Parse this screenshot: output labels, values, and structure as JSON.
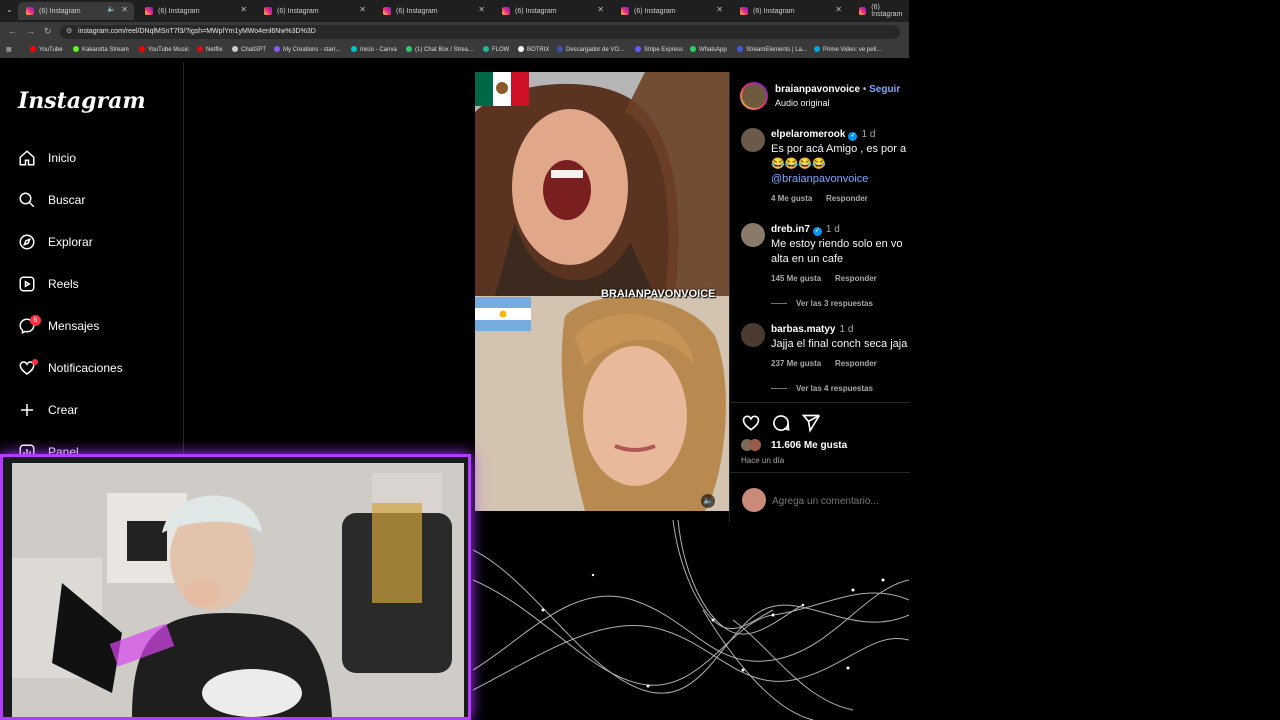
{
  "browser": {
    "tabs": [
      {
        "title": "(6) Instagram",
        "active": true
      },
      {
        "title": "(6) Instagram"
      },
      {
        "title": "(6) Instagram"
      },
      {
        "title": "(6) Instagram"
      },
      {
        "title": "(6) Instagram"
      },
      {
        "title": "(6) Instagram"
      },
      {
        "title": "(6) Instagram"
      },
      {
        "title": "(6) Instagram"
      }
    ],
    "url": "instagram.com/reel/DNqlMSnT7f3/?igsh=MWplYm1yMWo4enl6Nw%3D%3D",
    "bookmarks": [
      {
        "label": "YouTube",
        "color": "#ff0000"
      },
      {
        "label": "Kakarotta Stream",
        "color": "#53fc18"
      },
      {
        "label": "YouTube Music",
        "color": "#ff0000"
      },
      {
        "label": "Netflix",
        "color": "#e50914"
      },
      {
        "label": "ChatGPT",
        "color": "#cccccc"
      },
      {
        "label": "My Creations - starr...",
        "color": "#8a5cf6"
      },
      {
        "label": "Inicio - Canva",
        "color": "#00c4cc"
      },
      {
        "label": "(1) Chat Box / Strea...",
        "color": "#2ecc71"
      },
      {
        "label": "FLOW",
        "color": "#1abc9c"
      },
      {
        "label": "BOTRIX",
        "color": "#ffffff"
      },
      {
        "label": "Descargador de VO...",
        "color": "#3f51b5"
      },
      {
        "label": "Stripe Express",
        "color": "#635bff"
      },
      {
        "label": "WhatsApp",
        "color": "#25d366"
      },
      {
        "label": "StreamElements | La...",
        "color": "#3b5bdb"
      },
      {
        "label": "Prime Video: ve pelí...",
        "color": "#00a8e1"
      }
    ]
  },
  "sidebar": {
    "logo": "Instagram",
    "items": [
      {
        "label": "Inicio",
        "icon": "home-icon"
      },
      {
        "label": "Buscar",
        "icon": "search-icon"
      },
      {
        "label": "Explorar",
        "icon": "compass-icon"
      },
      {
        "label": "Reels",
        "icon": "reels-icon"
      },
      {
        "label": "Mensajes",
        "icon": "messenger-icon",
        "badge": "6"
      },
      {
        "label": "Notificaciones",
        "icon": "heart-icon",
        "dot": true
      },
      {
        "label": "Crear",
        "icon": "plus-icon"
      },
      {
        "label": "Panel",
        "icon": "dashboard-icon"
      }
    ]
  },
  "video": {
    "watermark": "BRAIANPAVONVOICE"
  },
  "post": {
    "author": "braianpavonvoice",
    "follow": "Seguir",
    "separator": "•",
    "audio": "Audio original",
    "comments": [
      {
        "user": "elpelaromerook",
        "verified": true,
        "time": "1 d",
        "line1": "Es por acá Amigo , es por a",
        "line2": "😂😂😂😂",
        "mention": "@braianpavonvoice",
        "likes": "4 Me gusta",
        "reply": "Responder",
        "more": ""
      },
      {
        "user": "dreb.in7",
        "verified": true,
        "time": "1 d",
        "line1": "Me estoy riendo solo en vo",
        "line2": "alta en un cafe",
        "likes": "145 Me gusta",
        "reply": "Responder",
        "more": "Ver las 3 respuestas"
      },
      {
        "user": "barbas.matyy",
        "verified": false,
        "time": "1 d",
        "line1": "Jajja el final conch seca jaja",
        "likes": "237 Me gusta",
        "reply": "Responder",
        "more": "Ver las 4 respuestas"
      }
    ],
    "likes": "11.606 Me gusta",
    "posted": "Hace un día",
    "add_comment_placeholder": "Agrega un comentario..."
  }
}
